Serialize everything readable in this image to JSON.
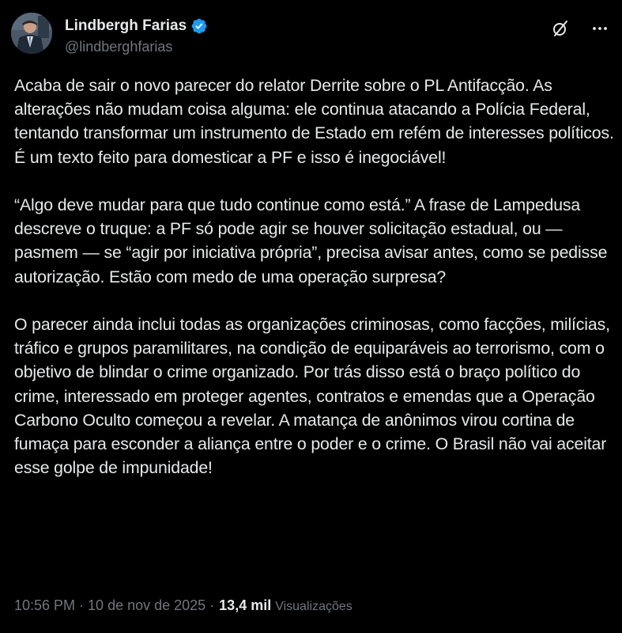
{
  "author": {
    "display_name": "Lindbergh Farias",
    "handle": "@lindberghfarias",
    "verified": true,
    "verified_color": "#1d9bf0"
  },
  "header_actions": {
    "grok_icon": "grok-slash-circle-icon",
    "more_icon": "more-dots-icon"
  },
  "tweet": {
    "paragraphs": [
      "Acaba de sair o novo parecer do relator Derrite sobre o PL Antifacção. As alterações não mudam coisa alguma: ele continua atacando a Polícia Federal, tentando transformar um instrumento de Estado em refém de interesses políticos. É um texto feito para domesticar a PF e isso é inegociável!",
      "“Algo deve mudar para que tudo continue como está.” A frase de Lampedusa descreve o truque: a PF só pode agir se houver solicitação estadual, ou — pasmem — se “agir por iniciativa própria”, precisa avisar antes, como se pedisse autorização. Estão com medo de uma operação surpresa?",
      "O parecer ainda inclui todas as organizações criminosas, como facções, milícias, tráfico e grupos paramilitares, na condição de equiparáveis ao terrorismo, com o objetivo de blindar o crime organizado. Por trás disso está o braço político do crime, interessado em proteger agentes, contratos e emendas que a Operação Carbono Oculto começou a revelar. A matança de anônimos virou cortina de fumaça para esconder a aliança entre o poder e o crime. O Brasil não vai aceitar esse golpe de impunidade!"
    ]
  },
  "meta": {
    "timestamp": "10:56 PM · 10 de nov de 2025 ·",
    "views_count": "13,4 mil",
    "views_label": "Visualizações"
  },
  "colors": {
    "background": "#000000",
    "text_primary": "#e7e9ea",
    "text_secondary": "#71767b"
  }
}
